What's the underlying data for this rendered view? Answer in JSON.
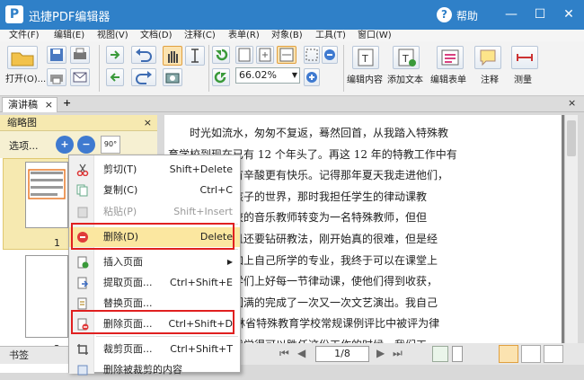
{
  "app": {
    "title": "迅捷PDF编辑器",
    "logo": "P",
    "help": "帮助"
  },
  "window_controls": {
    "min": "—",
    "max": "☐",
    "close": "✕"
  },
  "menu": [
    "文件(F)",
    "编辑(E)",
    "视图(V)",
    "文档(D)",
    "注释(C)",
    "表单(R)",
    "对象(B)",
    "工具(T)",
    "窗口(W)"
  ],
  "toolbar": {
    "open_label": "打开(O)...",
    "zoom_value": "66.02%",
    "edit_content": "编辑内容",
    "add_text": "添加文本",
    "edit_form": "编辑表单",
    "annotate": "注释",
    "measure": "测量"
  },
  "tabs": {
    "doc_tab": "演讲稿",
    "close": "×",
    "add": "+"
  },
  "panel": {
    "title": "缩略图",
    "options": "选项...",
    "rotate": "90°",
    "thumb1_num": "1",
    "thumb2_num": "2",
    "bookmarks": "书签"
  },
  "context_menu": {
    "items": [
      {
        "label": "剪切(T)",
        "shortcut": "Shift+Delete"
      },
      {
        "label": "复制(C)",
        "shortcut": "Ctrl+C"
      },
      {
        "label": "粘贴(P)",
        "shortcut": "Shift+Insert"
      },
      {
        "label": "删除(D)",
        "shortcut": "Delete"
      },
      {
        "label": "插入页面",
        "shortcut": "▶"
      },
      {
        "label": "提取页面...",
        "shortcut": "Ctrl+Shift+E"
      },
      {
        "label": "替换页面...",
        "shortcut": ""
      },
      {
        "label": "删除页面...",
        "shortcut": "Ctrl+Shift+D"
      },
      {
        "label": "裁剪页面...",
        "shortcut": "Ctrl+Shift+T"
      },
      {
        "label": "删除被裁剪的内容",
        "shortcut": ""
      }
    ]
  },
  "document": {
    "lines": [
      "　　时光如流水，匆匆不复返，蓦然回首，从我踏入特殊教",
      "育学校到现在已有 12 个年头了。再这 12 年的特教工作中有",
      "辛、有苦闷、有辛酸更有快乐。记得那年夏天我走进他们，",
      "进了这群特殊孩子的世界，那时我担任学生的律动课教",
      "由一名普通学校的音乐教师转变为一名特殊教师，但但",
      "学会手语，而且还要钻研教法，刚开始真的很难，但是经",
      "不懈的努力，加上自己所学的专业，我终于可以在课堂上",
      "刃有余的为同学们上好每一节律动课，使他们得到收获，",
      "且带领学生们圆满的完成了一次又一次文艺演出。我自己",
      "在 2009 年吉林省特殊教育学校常规课例评比中被评为律",
      "一等奖。正当我觉得可以胜任这份工作的时候，我们工"
    ]
  },
  "pager": {
    "page": "1/8"
  }
}
